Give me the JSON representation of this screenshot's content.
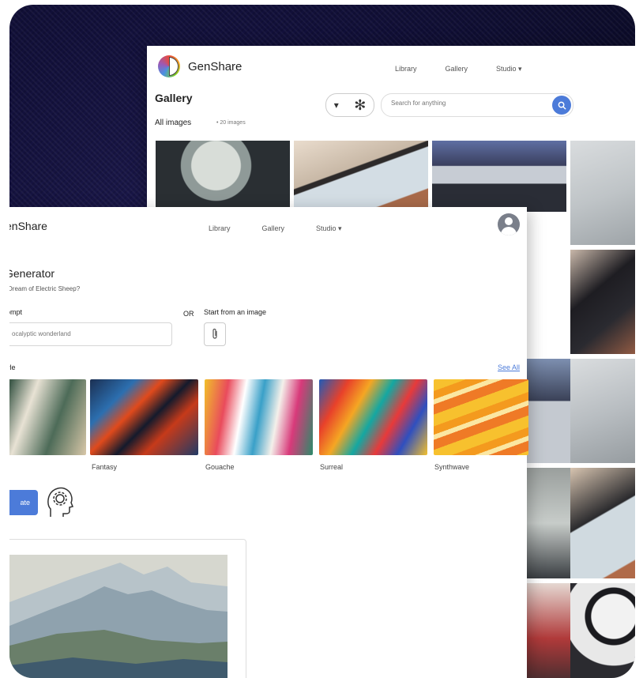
{
  "back_window": {
    "brand": "GenShare",
    "nav": [
      "Library",
      "Gallery",
      "Studio ▾"
    ],
    "title": "Gallery",
    "all_images": "All images",
    "count": "• 20 images",
    "selector_caret": "▾",
    "selector_icon": "✻",
    "search_placeholder": "Search for anything",
    "search_icon": "search-icon"
  },
  "front_window": {
    "brand": "enShare",
    "nav": [
      "Library",
      "Gallery",
      "Studio ▾"
    ],
    "generator_title": "Generator",
    "generator_subtitle": "Dream of Electric Sheep?",
    "prompt_label": "ompt",
    "prompt_placeholder": "ocalyptic wonderland",
    "or_label": "OR",
    "start_from_image": "Start from an image",
    "style_label": "yle",
    "see_all": "See All",
    "styles": [
      "",
      "Fantasy",
      "Gouache",
      "Surreal",
      "Synthwave"
    ],
    "generate_button": "ate"
  },
  "colors": {
    "accent": "#4c7bd9",
    "background": "#12103a"
  }
}
